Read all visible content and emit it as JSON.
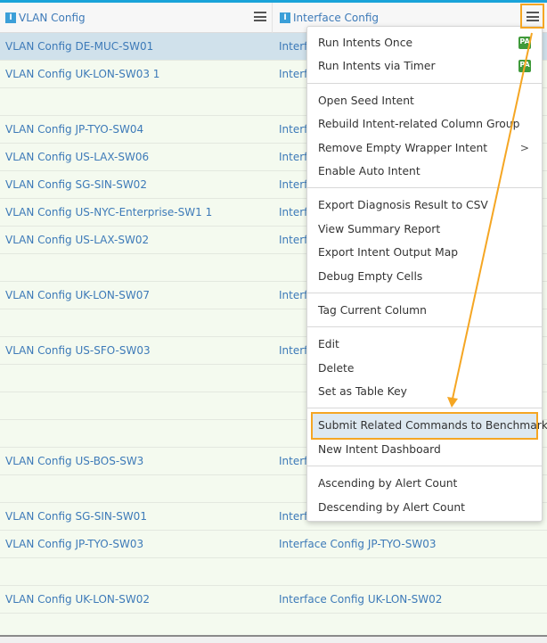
{
  "header": {
    "col1": {
      "badge": "I",
      "title": "VLAN Config"
    },
    "col2": {
      "badge": "I",
      "title": "Interface Config"
    }
  },
  "rows": [
    {
      "c1": "VLAN Config DE-MUC-SW01",
      "c2": "Interf",
      "selected": true
    },
    {
      "c1": "VLAN Config UK-LON-SW03 1",
      "c2": "Interf"
    },
    {
      "c1": "",
      "c2": ""
    },
    {
      "c1": "VLAN Config JP-TYO-SW04",
      "c2": "Interf"
    },
    {
      "c1": "VLAN Config US-LAX-SW06",
      "c2": "Interf"
    },
    {
      "c1": "VLAN Config SG-SIN-SW02",
      "c2": "Interf"
    },
    {
      "c1": "VLAN Config US-NYC-Enterprise-SW1 1",
      "c2": "Interf"
    },
    {
      "c1": "VLAN Config US-LAX-SW02",
      "c2": "Interf"
    },
    {
      "c1": "",
      "c2": ""
    },
    {
      "c1": "VLAN Config UK-LON-SW07",
      "c2": "Interf"
    },
    {
      "c1": "",
      "c2": ""
    },
    {
      "c1": "VLAN Config US-SFO-SW03",
      "c2": "Interf"
    },
    {
      "c1": "",
      "c2": ""
    },
    {
      "c1": "",
      "c2": ""
    },
    {
      "c1": "",
      "c2": ""
    },
    {
      "c1": "VLAN Config US-BOS-SW3",
      "c2": "Interf"
    },
    {
      "c1": "",
      "c2": ""
    },
    {
      "c1": "VLAN Config SG-SIN-SW01",
      "c2": "Interf"
    },
    {
      "c1": "VLAN Config JP-TYO-SW03",
      "c2": "Interface Config JP-TYO-SW03"
    },
    {
      "c1": "",
      "c2": ""
    },
    {
      "c1": "VLAN Config UK-LON-SW02",
      "c2": "Interface Config UK-LON-SW02"
    },
    {
      "c1": "",
      "c2": ""
    }
  ],
  "menu": {
    "groups": [
      [
        {
          "label": "Run Intents Once",
          "badge": "PA"
        },
        {
          "label": "Run Intents via Timer",
          "badge": "PA"
        }
      ],
      [
        {
          "label": "Open Seed Intent"
        },
        {
          "label": "Rebuild Intent-related Column Group"
        },
        {
          "label": "Remove Empty Wrapper Intent",
          "submenu": ">"
        },
        {
          "label": "Enable Auto Intent"
        }
      ],
      [
        {
          "label": "Export Diagnosis Result to CSV"
        },
        {
          "label": "View Summary Report"
        },
        {
          "label": "Export Intent Output Map"
        },
        {
          "label": "Debug Empty Cells"
        }
      ],
      [
        {
          "label": "Tag Current Column"
        }
      ],
      [
        {
          "label": "Edit"
        },
        {
          "label": "Delete"
        },
        {
          "label": "Set as Table Key"
        }
      ],
      [
        {
          "label": "Submit Related Commands to Benchmark",
          "highlighted": true
        },
        {
          "label": "New Intent Dashboard"
        }
      ],
      [
        {
          "label": "Ascending by Alert Count"
        },
        {
          "label": "Descending by Alert Count"
        }
      ]
    ]
  },
  "colors": {
    "accent": "#1aa3d9",
    "link": "#3d7ab8",
    "highlight": "#f5a623",
    "row": "#f4faef",
    "selected": "#d0e1eb"
  }
}
